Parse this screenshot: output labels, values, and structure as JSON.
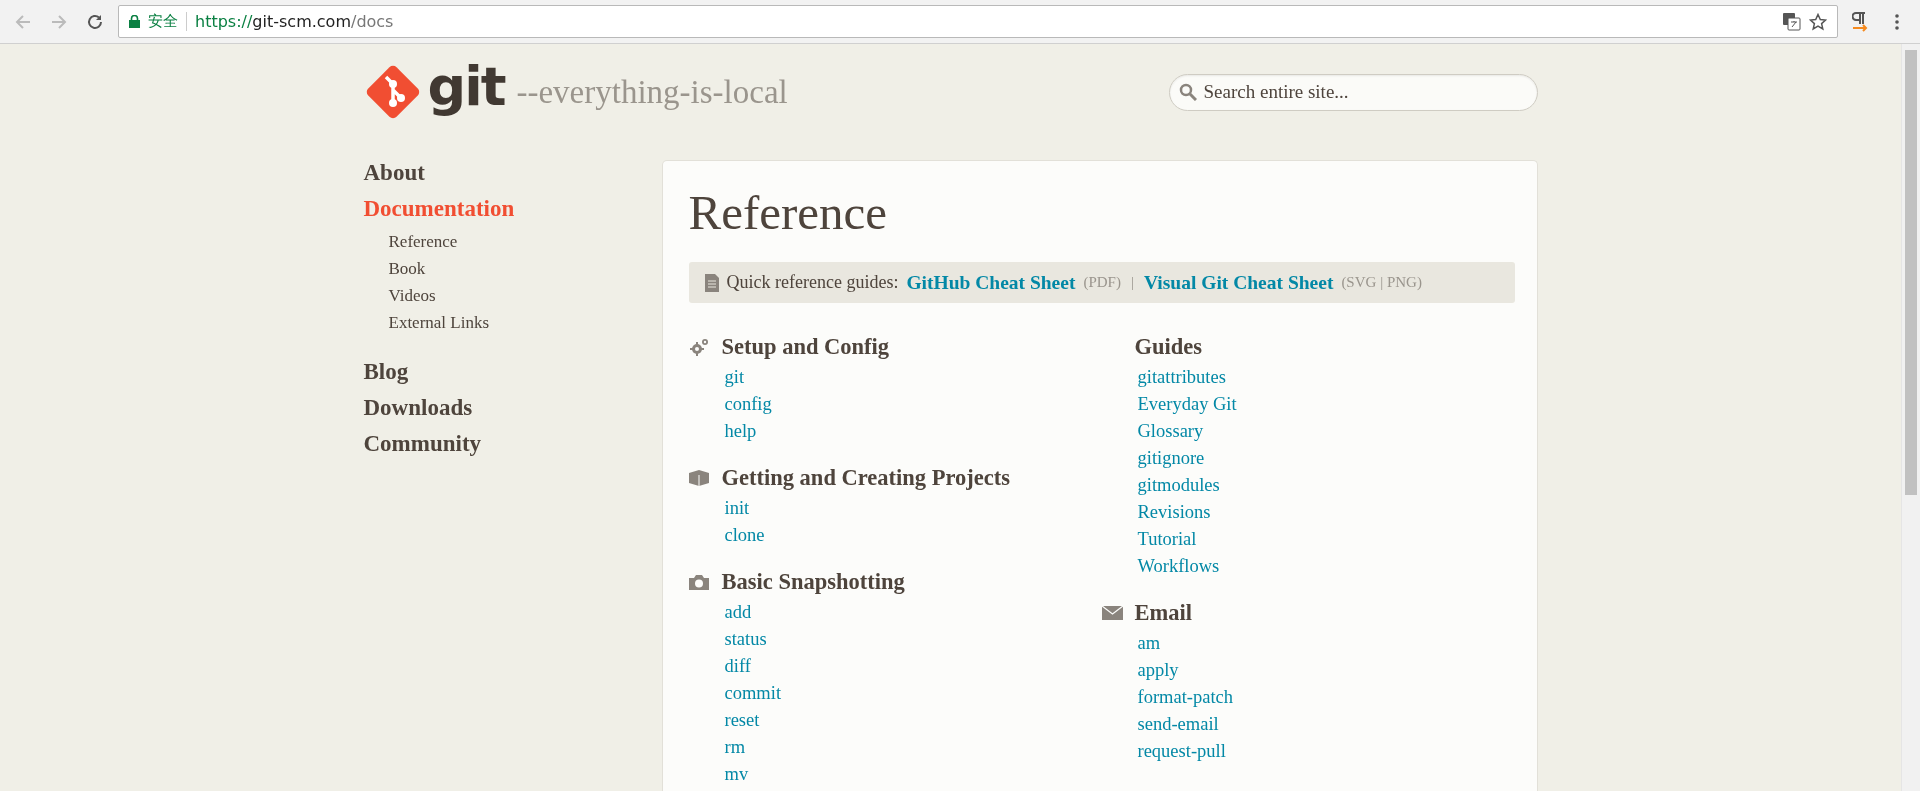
{
  "browser": {
    "secure_label": "安全",
    "url_scheme": "https://",
    "url_host": "git-scm.com",
    "url_path": "/docs"
  },
  "header": {
    "logo_text": "git",
    "tagline": "--everything-is-local",
    "search": {
      "placeholder": "Search entire site..."
    }
  },
  "sidebar": {
    "items": [
      {
        "label": "About",
        "selected": false
      },
      {
        "label": "Documentation",
        "selected": true,
        "children": [
          {
            "label": "Reference"
          },
          {
            "label": "Book"
          },
          {
            "label": "Videos"
          },
          {
            "label": "External Links"
          }
        ]
      },
      {
        "label": "Blog",
        "selected": false
      },
      {
        "label": "Downloads",
        "selected": false
      },
      {
        "label": "Community",
        "selected": false
      }
    ]
  },
  "content": {
    "title": "Reference",
    "quick_reference": {
      "label": "Quick reference guides:",
      "separator": "|",
      "links": [
        {
          "label": "GitHub Cheat Sheet",
          "formats": "(PDF)"
        },
        {
          "label": "Visual Git Cheat Sheet",
          "formats": "(SVG | PNG)"
        }
      ]
    },
    "columns": [
      [
        {
          "title": "Setup and Config",
          "links": [
            "git",
            "config",
            "help"
          ]
        },
        {
          "title": "Getting and Creating Projects",
          "links": [
            "init",
            "clone"
          ]
        },
        {
          "title": "Basic Snapshotting",
          "links": [
            "add",
            "status",
            "diff",
            "commit",
            "reset",
            "rm",
            "mv"
          ]
        }
      ],
      [
        {
          "title": "Guides",
          "links": [
            "gitattributes",
            "Everyday Git",
            "Glossary",
            "gitignore",
            "gitmodules",
            "Revisions",
            "Tutorial",
            "Workflows"
          ]
        },
        {
          "title": "Email",
          "links": [
            "am",
            "apply",
            "format-patch",
            "send-email",
            "request-pull"
          ]
        }
      ]
    ]
  }
}
